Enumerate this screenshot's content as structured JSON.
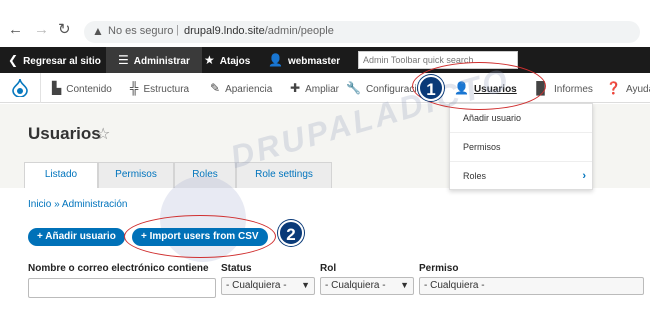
{
  "browser": {
    "back_icon": "arrow-left-icon",
    "forward_icon": "arrow-right-icon",
    "reload_icon": "reload-icon",
    "security_text": "No es seguro",
    "url_host": "drupal9.lndo.site",
    "url_path": "/admin/people"
  },
  "toolbar": {
    "back_site": "Regresar al sitio",
    "admin": "Administrar",
    "shortcuts": "Atajos",
    "user": "webmaster",
    "search_placeholder": "Admin Toolbar quick search"
  },
  "tray": {
    "items": [
      {
        "label": "Contenido",
        "icon": "file-icon"
      },
      {
        "label": "Estructura",
        "icon": "sitemap-icon"
      },
      {
        "label": "Apariencia",
        "icon": "brush-icon"
      },
      {
        "label": "Ampliar",
        "icon": "puzzle-icon"
      },
      {
        "label": "Configuración",
        "icon": "wrench-icon"
      },
      {
        "label": "Usuarios",
        "icon": "user-icon"
      },
      {
        "label": "Informes",
        "icon": "bar-chart-icon"
      },
      {
        "label": "Ayuda",
        "icon": "help-icon"
      }
    ]
  },
  "dropdown": {
    "items": [
      "Añadir usuario",
      "Permisos",
      "Roles"
    ]
  },
  "page": {
    "title": "Usuarios",
    "tabs": [
      "Listado",
      "Permisos",
      "Roles",
      "Role settings"
    ],
    "breadcrumb": "Inicio » Administración",
    "add_user_button": "+ Añadir usuario",
    "import_button": "+ Import users from CSV"
  },
  "filters": {
    "name_label": "Nombre o correo electrónico contiene",
    "status_label": "Status",
    "status_value": "- Cualquiera -",
    "role_label": "Rol",
    "role_value": "- Cualquiera -",
    "permission_label": "Permiso",
    "permission_value": "- Cualquiera -"
  },
  "annotations": {
    "badge_1": "1",
    "badge_2": "2",
    "watermark": "DRUPALADICTO",
    "accent_color": "#d03030",
    "badge_color": "#0a3a78"
  }
}
